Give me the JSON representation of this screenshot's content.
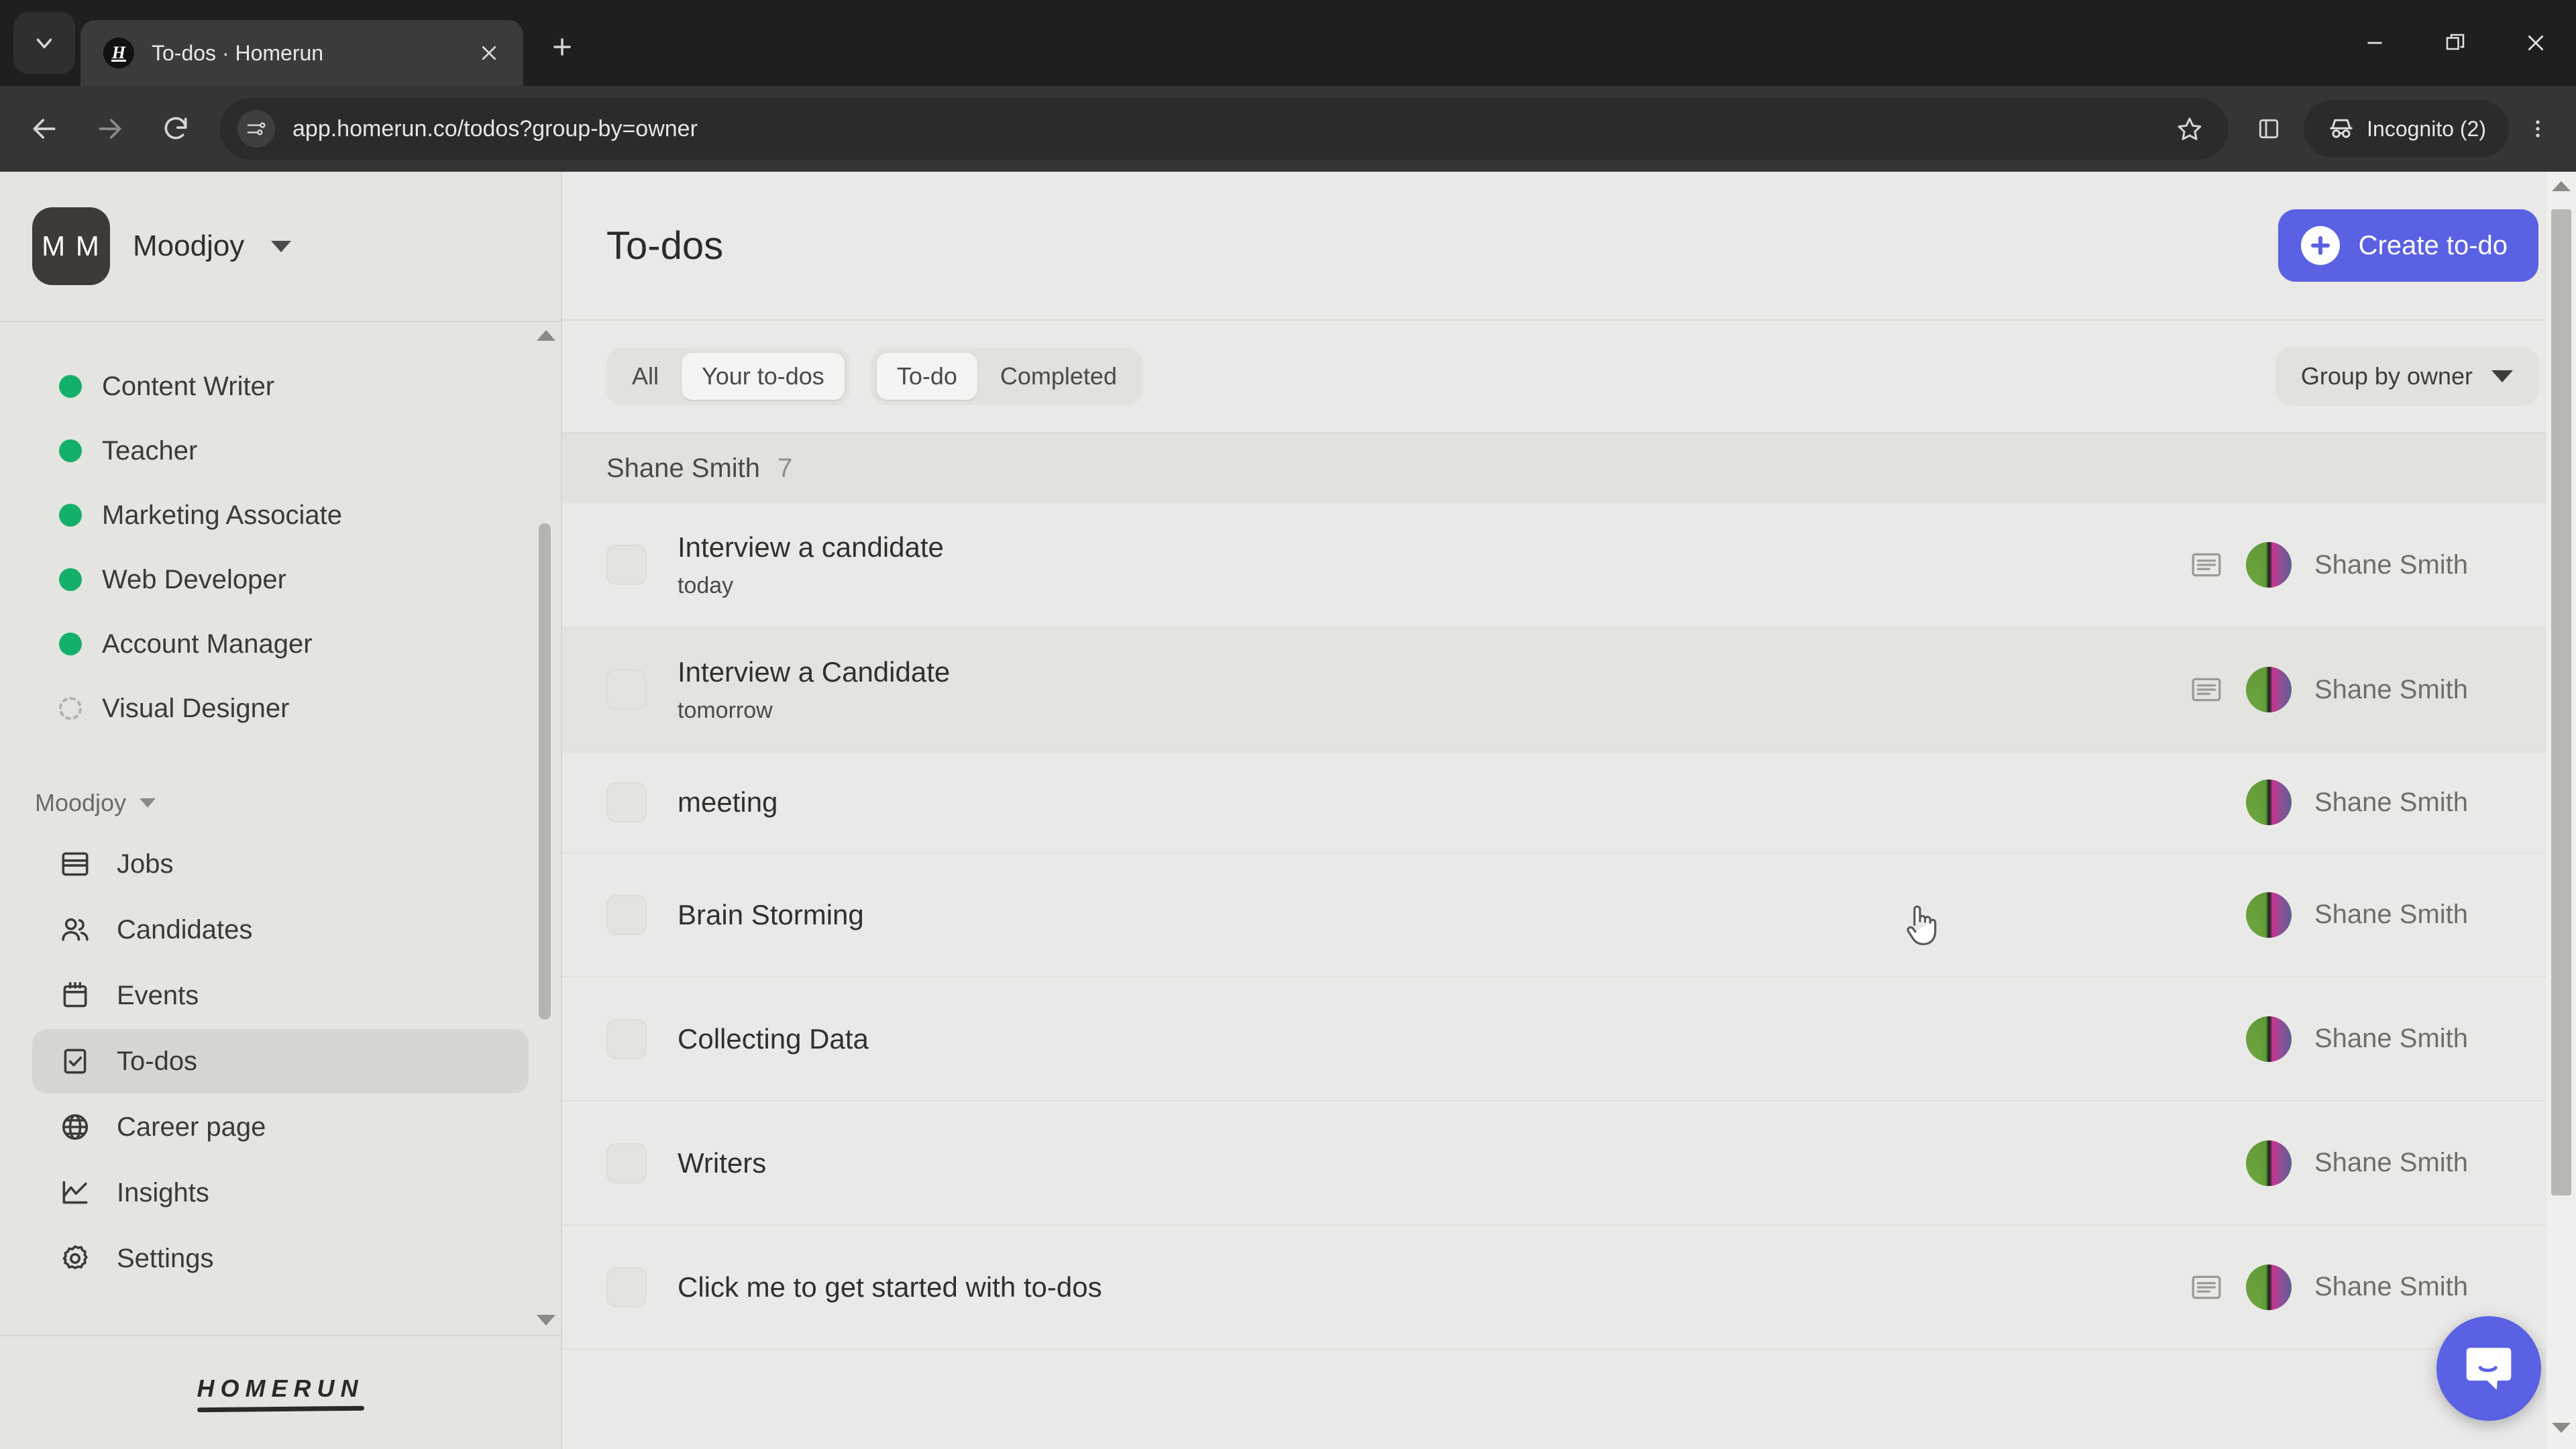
{
  "browser": {
    "tab": {
      "title": "To-dos · Homerun",
      "favicon_letter": "H",
      "close_label": "×"
    },
    "new_tab_label": "+",
    "tab_search_name": "tab-search",
    "url": "app.homerun.co/todos?group-by=owner",
    "profile_label": "Incognito (2)",
    "window": {
      "minimize": "—",
      "maximize": "❐",
      "close": "✕"
    }
  },
  "sidebar": {
    "org": {
      "initials": "M M",
      "name": "Moodjoy"
    },
    "jobs": [
      {
        "label": "Content Writer",
        "status": "published"
      },
      {
        "label": "Teacher",
        "status": "published"
      },
      {
        "label": "Marketing Associate",
        "status": "published"
      },
      {
        "label": "Web Developer",
        "status": "published"
      },
      {
        "label": "Account Manager",
        "status": "published"
      },
      {
        "label": "Visual Designer",
        "status": "draft"
      }
    ],
    "section_label": "Moodjoy",
    "nav": [
      {
        "label": "Jobs",
        "icon": "table-icon",
        "active": false
      },
      {
        "label": "Candidates",
        "icon": "people-icon",
        "active": false
      },
      {
        "label": "Events",
        "icon": "calendar-icon",
        "active": false
      },
      {
        "label": "To-dos",
        "icon": "checkbox-icon",
        "active": true
      },
      {
        "label": "Career page",
        "icon": "globe-icon",
        "active": false
      },
      {
        "label": "Insights",
        "icon": "chart-line-icon",
        "active": false
      },
      {
        "label": "Settings",
        "icon": "gear-icon",
        "active": false
      }
    ],
    "logo": "HOMERUN"
  },
  "main": {
    "title": "To-dos",
    "create_button": "Create to-do",
    "filters": {
      "scope": {
        "options": [
          "All",
          "Your to-dos"
        ],
        "selected": "Your to-dos"
      },
      "state": {
        "options": [
          "To-do",
          "Completed"
        ],
        "selected": "To-do"
      },
      "group_by": "Group by owner"
    },
    "group": {
      "name": "Shane Smith",
      "count": "7"
    },
    "todos": [
      {
        "title": "Interview a candidate",
        "due": "today",
        "has_note": true,
        "owner": "Shane Smith",
        "hover": false
      },
      {
        "title": "Interview a Candidate",
        "due": "tomorrow",
        "has_note": true,
        "owner": "Shane Smith",
        "hover": true
      },
      {
        "title": "meeting",
        "due": "",
        "has_note": false,
        "owner": "Shane Smith",
        "hover": false
      },
      {
        "title": "Brain Storming",
        "due": "",
        "has_note": false,
        "owner": "Shane Smith",
        "hover": false
      },
      {
        "title": "Collecting Data",
        "due": "",
        "has_note": false,
        "owner": "Shane Smith",
        "hover": false
      },
      {
        "title": "Writers",
        "due": "",
        "has_note": false,
        "owner": "Shane Smith",
        "hover": false
      },
      {
        "title": "Click me to get started with to-dos",
        "due": "",
        "has_note": true,
        "owner": "Shane Smith",
        "hover": false
      }
    ]
  },
  "colors": {
    "accent": "#5b61e3",
    "published_dot": "#13b06a",
    "page_bg": "#e9e9e7",
    "sidebar_bg": "#e4e4e1"
  }
}
